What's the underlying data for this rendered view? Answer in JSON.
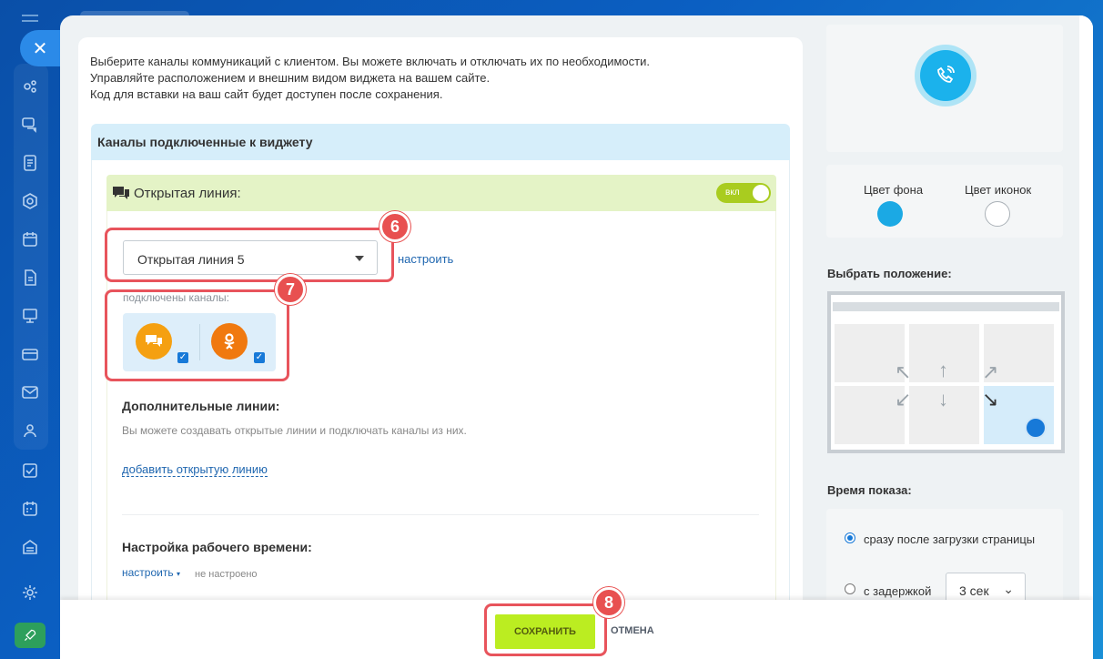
{
  "intro": {
    "line1": "Выберите каналы коммуникаций с клиентом. Вы можете включать и отключать их по необходимости.",
    "line2": "Управляйте расположением и внешним видом виджета на вашем сайте.",
    "line3": "Код для вставки на ваш сайт будет доступен после сохранения."
  },
  "channels": {
    "header": "Каналы подключенные к виджету",
    "open_line": {
      "title": "Открытая линия:",
      "toggle_label": "вкл",
      "selected": "Открытая линия 5",
      "configure": "настроить",
      "connected_label": "подключены каналы:",
      "connected": [
        {
          "icon": "openline-chat-icon",
          "checked": true
        },
        {
          "icon": "odnoklassniki-icon",
          "checked": true
        }
      ]
    },
    "extra": {
      "title": "Дополнительные линии:",
      "desc": "Вы можете создавать открытые линии и подключать каналы из них.",
      "add_link": "добавить открытую линию"
    },
    "work_time": {
      "title": "Настройка рабочего времени:",
      "configure": "настроить",
      "status": "не настроено"
    }
  },
  "appearance": {
    "bg_color_label": "Цвет фона",
    "icon_color_label": "Цвет иконок",
    "bg_color": "#1ba9e4",
    "icon_color": "#ffffff",
    "position_title": "Выбрать положение:",
    "selected_position": "bottom-right"
  },
  "show_time": {
    "title": "Время показа:",
    "option_immediate": "сразу после загрузки страницы",
    "option_delay": "с задержкой",
    "delay_value": "3 сек",
    "selected": "immediate"
  },
  "footer": {
    "save_label": "СОХРАНИТЬ",
    "cancel_label": "ОТМЕНА"
  },
  "callouts": {
    "c6": "6",
    "c7": "7",
    "c8": "8"
  },
  "colors": {
    "accent": "#bbed21",
    "callout": "#e85050",
    "link": "#2067b0"
  }
}
